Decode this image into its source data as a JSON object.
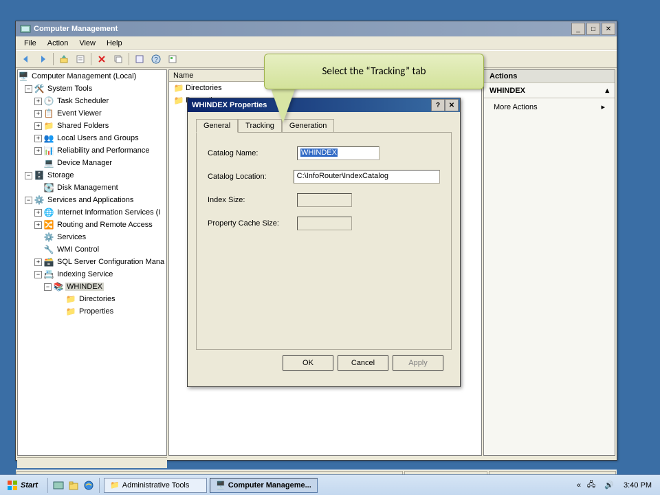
{
  "window": {
    "title": "Computer Management",
    "menu": {
      "file": "File",
      "action": "Action",
      "view": "View",
      "help": "Help"
    }
  },
  "tree": {
    "root": "Computer Management (Local)",
    "system_tools": "System Tools",
    "task_scheduler": "Task Scheduler",
    "event_viewer": "Event Viewer",
    "shared_folders": "Shared Folders",
    "local_users": "Local Users and Groups",
    "reliability": "Reliability and Performance",
    "device_manager": "Device Manager",
    "storage": "Storage",
    "disk_mgmt": "Disk Management",
    "services_apps": "Services and Applications",
    "iis": "Internet Information Services (I",
    "routing": "Routing and Remote Access",
    "services": "Services",
    "wmi": "WMI Control",
    "sql": "SQL Server Configuration Mana",
    "indexing": "Indexing Service",
    "whindex": "WHINDEX",
    "directories": "Directories",
    "properties": "Properties"
  },
  "list": {
    "header_name": "Name",
    "item_directories": "Directories",
    "item_properties": "Properties"
  },
  "actions": {
    "title": "Actions",
    "whindex": "WHINDEX",
    "more": "More Actions"
  },
  "dialog": {
    "title": "WHINDEX Properties",
    "tabs": {
      "general": "General",
      "tracking": "Tracking",
      "generation": "Generation"
    },
    "labels": {
      "catalog_name": "Catalog Name:",
      "catalog_location": "Catalog Location:",
      "index_size": "Index Size:",
      "property_cache": "Property Cache Size:"
    },
    "values": {
      "catalog_name": "WHINDEX",
      "catalog_location": "C:\\InfoRouter\\IndexCatalog",
      "index_size": "",
      "property_cache": ""
    },
    "buttons": {
      "ok": "OK",
      "cancel": "Cancel",
      "apply": "Apply"
    }
  },
  "callout": "Select the “Tracking” tab",
  "taskbar": {
    "start": "Start",
    "admin_tools": "Administrative Tools",
    "comp_mgmt": "Computer Manageme...",
    "clock": "3:40 PM",
    "chev": "«"
  }
}
